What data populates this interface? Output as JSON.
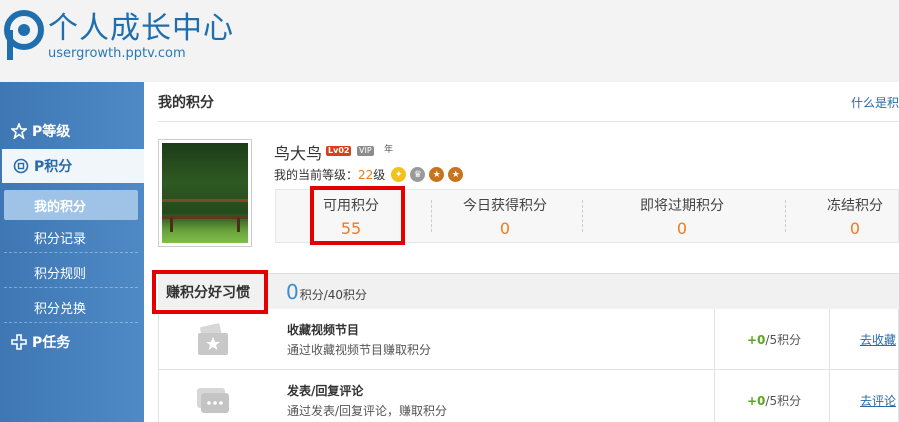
{
  "header": {
    "title": "个人成长中心",
    "subtitle": "usergrowth.pptv.com"
  },
  "sidebar": {
    "groups": [
      {
        "label": "P等级"
      },
      {
        "label": "P积分"
      },
      {
        "label": "P任务"
      }
    ],
    "items": [
      {
        "label": "我的积分"
      },
      {
        "label": "积分记录"
      },
      {
        "label": "积分规则"
      },
      {
        "label": "积分兑换"
      }
    ]
  },
  "main": {
    "title": "我的积分",
    "help_link": "什么是积",
    "profile": {
      "username": "鸟大鸟",
      "lv_badge": "Lv02",
      "vip_badge": "VIP",
      "year_badge": "年",
      "level_prefix": "我的当前等级：",
      "level_value": "22",
      "level_suffix": "级"
    },
    "points": [
      {
        "label": "可用积分",
        "value": "55"
      },
      {
        "label": "今日获得积分",
        "value": "0"
      },
      {
        "label": "即将过期积分",
        "value": "0"
      },
      {
        "label": "冻结积分",
        "value": "0"
      }
    ],
    "habits": {
      "title": "赚积分好习惯",
      "earned": "0",
      "total_text": "积分/40积分",
      "rows": [
        {
          "title": "收藏视频节目",
          "desc": "通过收藏视频节目赚取积分",
          "earned": "+0",
          "limit": "/5积分",
          "action": "去收藏"
        },
        {
          "title": "发表/回复评论",
          "desc": "通过发表/回复评论，赚取积分",
          "earned": "+0",
          "limit": "/5积分",
          "action": "去评论"
        }
      ]
    }
  },
  "colors": {
    "brand_blue": "#1f6fae",
    "sidebar_blue": "#4a84c0",
    "points_orange": "#ef7a20",
    "highlight_red": "#e50000",
    "plus_green": "#5aa81e"
  }
}
